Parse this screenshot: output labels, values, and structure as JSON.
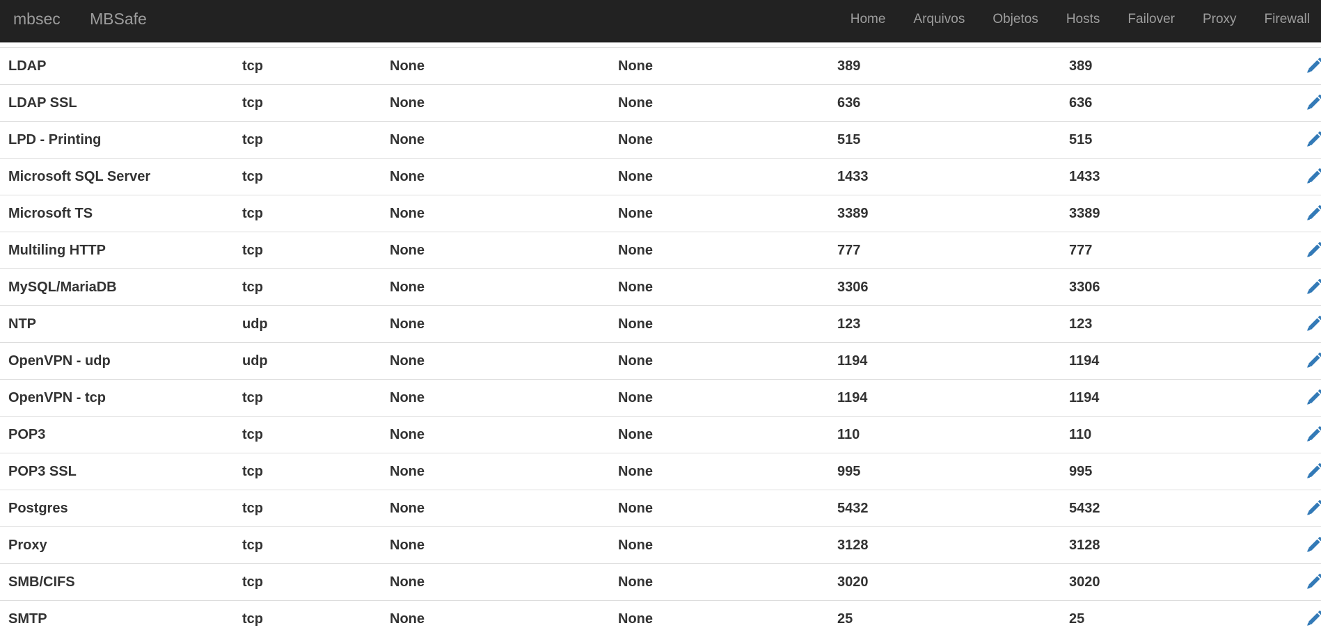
{
  "navbar": {
    "brand_primary": "mbsec",
    "brand_secondary": "MBSafe",
    "items": [
      "Home",
      "Arquivos",
      "Objetos",
      "Hosts",
      "Failover",
      "Proxy",
      "Firewall"
    ]
  },
  "colors": {
    "navbar_bg": "#222222",
    "nav_text": "#9d9d9d",
    "icon_blue": "#337ab7",
    "row_text": "#333333"
  },
  "icons": {
    "edit": "pencil-icon",
    "delete": "trash-icon"
  },
  "services": [
    {
      "name": "LDAP",
      "protocol": "tcp",
      "source": "None",
      "destination": "None",
      "port_start": "389",
      "port_end": "389"
    },
    {
      "name": "LDAP SSL",
      "protocol": "tcp",
      "source": "None",
      "destination": "None",
      "port_start": "636",
      "port_end": "636"
    },
    {
      "name": "LPD - Printing",
      "protocol": "tcp",
      "source": "None",
      "destination": "None",
      "port_start": "515",
      "port_end": "515"
    },
    {
      "name": "Microsoft SQL Server",
      "protocol": "tcp",
      "source": "None",
      "destination": "None",
      "port_start": "1433",
      "port_end": "1433"
    },
    {
      "name": "Microsoft TS",
      "protocol": "tcp",
      "source": "None",
      "destination": "None",
      "port_start": "3389",
      "port_end": "3389"
    },
    {
      "name": "Multiling HTTP",
      "protocol": "tcp",
      "source": "None",
      "destination": "None",
      "port_start": "777",
      "port_end": "777"
    },
    {
      "name": "MySQL/MariaDB",
      "protocol": "tcp",
      "source": "None",
      "destination": "None",
      "port_start": "3306",
      "port_end": "3306"
    },
    {
      "name": "NTP",
      "protocol": "udp",
      "source": "None",
      "destination": "None",
      "port_start": "123",
      "port_end": "123"
    },
    {
      "name": "OpenVPN - udp",
      "protocol": "udp",
      "source": "None",
      "destination": "None",
      "port_start": "1194",
      "port_end": "1194"
    },
    {
      "name": "OpenVPN - tcp",
      "protocol": "tcp",
      "source": "None",
      "destination": "None",
      "port_start": "1194",
      "port_end": "1194"
    },
    {
      "name": "POP3",
      "protocol": "tcp",
      "source": "None",
      "destination": "None",
      "port_start": "110",
      "port_end": "110"
    },
    {
      "name": "POP3 SSL",
      "protocol": "tcp",
      "source": "None",
      "destination": "None",
      "port_start": "995",
      "port_end": "995"
    },
    {
      "name": "Postgres",
      "protocol": "tcp",
      "source": "None",
      "destination": "None",
      "port_start": "5432",
      "port_end": "5432"
    },
    {
      "name": "Proxy",
      "protocol": "tcp",
      "source": "None",
      "destination": "None",
      "port_start": "3128",
      "port_end": "3128"
    },
    {
      "name": "SMB/CIFS",
      "protocol": "tcp",
      "source": "None",
      "destination": "None",
      "port_start": "3020",
      "port_end": "3020"
    },
    {
      "name": "SMTP",
      "protocol": "tcp",
      "source": "None",
      "destination": "None",
      "port_start": "25",
      "port_end": "25"
    }
  ]
}
